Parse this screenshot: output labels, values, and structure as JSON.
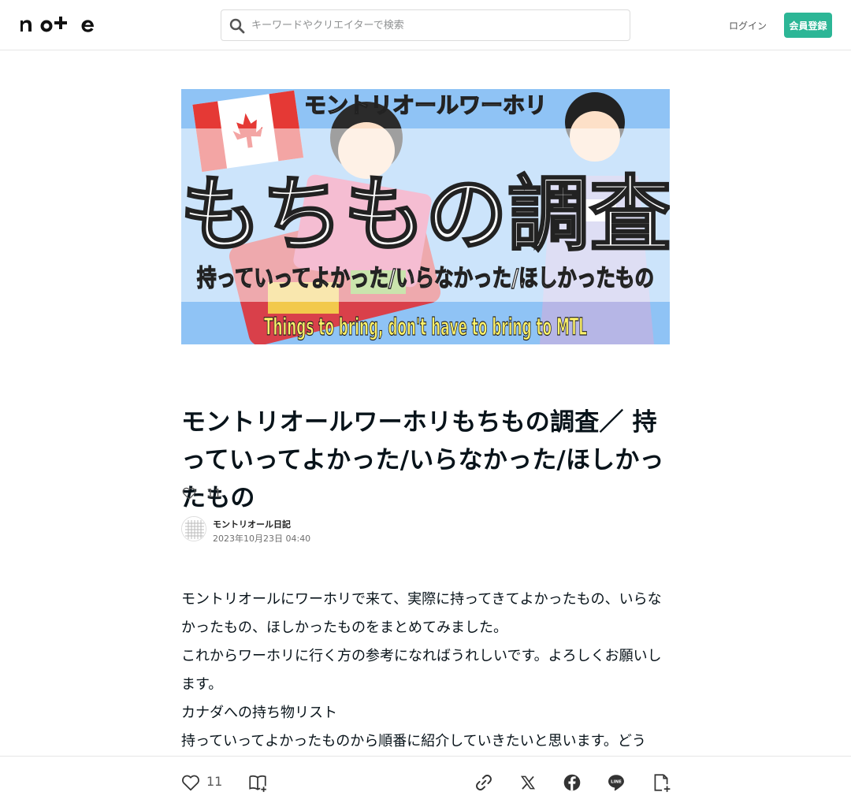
{
  "header": {
    "logo_text": "note",
    "search_placeholder": "キーワードやクリエイターで検索",
    "login_label": "ログイン",
    "signup_label": "会員登録"
  },
  "hero": {
    "top_text": "モントリオールワーホリ",
    "big_text": "もちもの調査",
    "sub_text": "持っていってよかった/いらなかった/ほしかったもの",
    "english_text": "Things to bring, don't have to bring to MTL"
  },
  "article": {
    "title": "モントリオールワーホリもちもの調査／ 持っていってよかった/いらなかった/ほしかったもの",
    "likes": "11",
    "author": "モントリオール日記",
    "date": "2023年10月23日 04:40",
    "paragraphs": [
      "モントリオールにワーホリで来て、実際に持ってきてよかったもの、いらなかったもの、ほしかったものをまとめてみました。",
      "これからワーホリに行く方の参考になればうれしいです。よろしくお願いします。",
      "カナダへの持ち物リスト",
      "持っていってよかったものから順番に紹介していきたいと思います。どうぞ。"
    ]
  },
  "bottom_bar": {
    "likes": "11"
  },
  "colors": {
    "accent": "#2cb696",
    "text": "#08131a",
    "hero_sky": "#8fc3f5"
  },
  "icons": [
    "search-icon",
    "heart-icon",
    "magazine-add-icon",
    "link-icon",
    "x-icon",
    "facebook-icon",
    "line-icon",
    "note-add-icon"
  ]
}
